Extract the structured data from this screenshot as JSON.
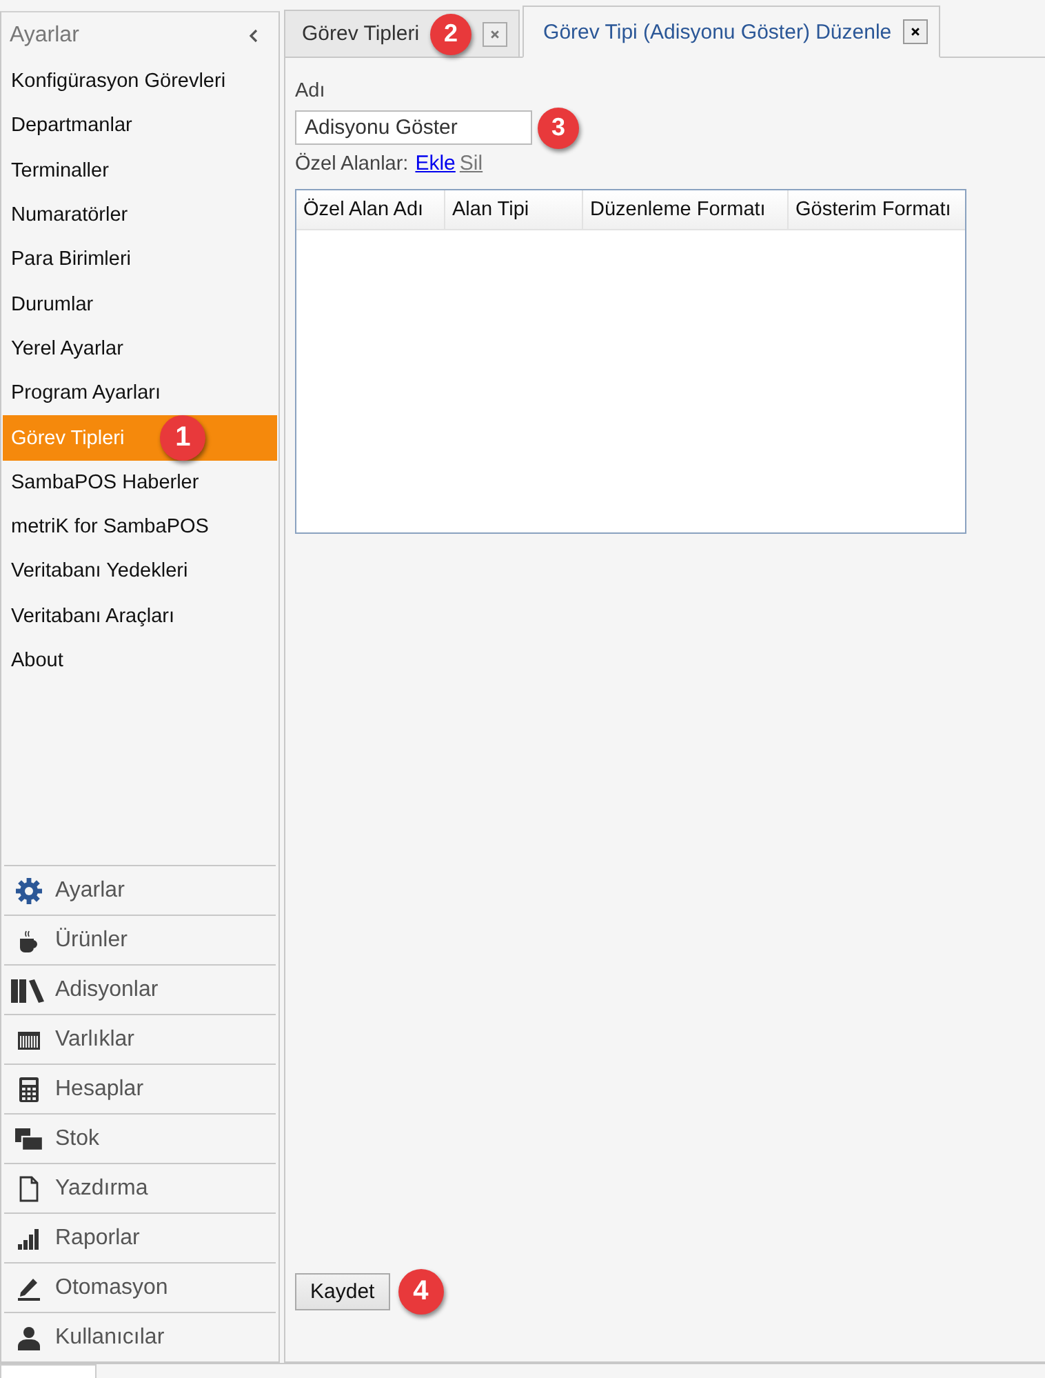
{
  "sidebar": {
    "title": "Ayarlar",
    "items": [
      {
        "label": "Konfigürasyon Görevleri",
        "selected": false
      },
      {
        "label": "Departmanlar",
        "selected": false
      },
      {
        "label": "Terminaller",
        "selected": false
      },
      {
        "label": "Numaratörler",
        "selected": false
      },
      {
        "label": "Para Birimleri",
        "selected": false
      },
      {
        "label": "Durumlar",
        "selected": false
      },
      {
        "label": "Yerel Ayarlar",
        "selected": false
      },
      {
        "label": "Program Ayarları",
        "selected": false
      },
      {
        "label": "Görev Tipleri",
        "selected": true,
        "badge": "1"
      },
      {
        "label": "SambaPOS Haberler",
        "selected": false
      },
      {
        "label": "metriK for SambaPOS",
        "selected": false
      },
      {
        "label": "Veritabanı Yedekleri",
        "selected": false
      },
      {
        "label": "Veritabanı Araçları",
        "selected": false
      },
      {
        "label": "About",
        "selected": false
      }
    ],
    "nav": [
      {
        "label": "Ayarlar",
        "kind": "gear"
      },
      {
        "label": "Ürünler",
        "kind": "cup"
      },
      {
        "label": "Adisyonlar",
        "kind": "books"
      },
      {
        "label": "Varlıklar",
        "kind": "grid"
      },
      {
        "label": "Hesaplar",
        "kind": "calculator"
      },
      {
        "label": "Stok",
        "kind": "squares"
      },
      {
        "label": "Yazdırma",
        "kind": "page"
      },
      {
        "label": "Raporlar",
        "kind": "bars"
      },
      {
        "label": "Otomasyon",
        "kind": "pen"
      },
      {
        "label": "Kullanıcılar",
        "kind": "user"
      }
    ]
  },
  "tabs": [
    {
      "label": "Görev Tipleri",
      "selected": false,
      "badge": "2"
    },
    {
      "label": "Görev Tipi (Adisyonu Göster) Düzenle",
      "selected": true
    }
  ],
  "editor": {
    "name_label": "Adı",
    "name_value": "Adisyonu Göster",
    "name_badge": "3",
    "fields_label": "Özel Alanlar:",
    "links": [
      {
        "label": "Ekle",
        "disabled": false
      },
      {
        "label": "Sil",
        "disabled": true
      }
    ],
    "columns": [
      "Özel Alan Adı",
      "Alan Tipi",
      "Düzenleme Formatı",
      "Gösterim Formatı"
    ],
    "save_button": "Kaydet",
    "save_badge": "4"
  }
}
